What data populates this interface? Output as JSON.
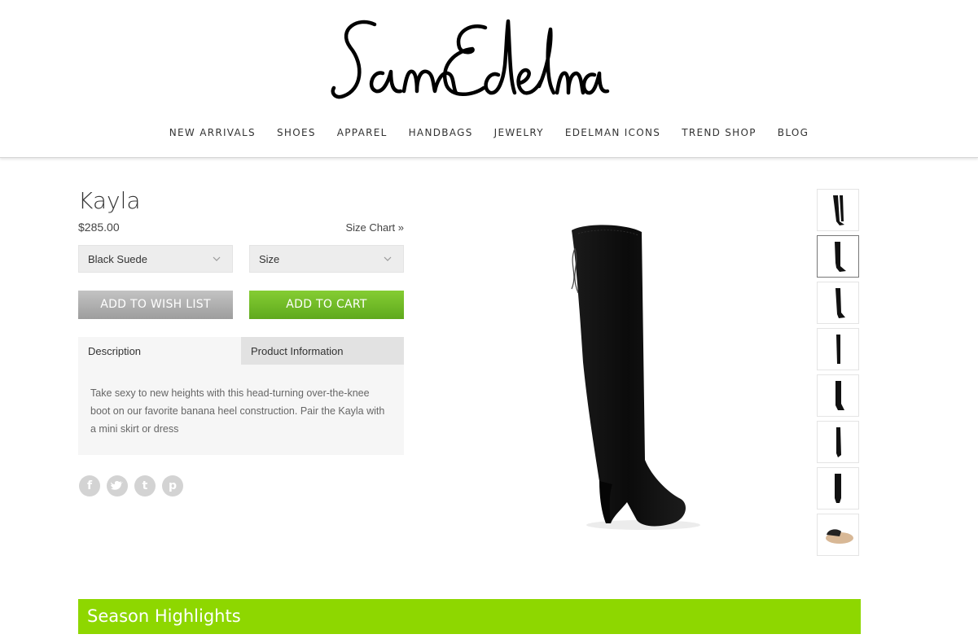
{
  "brand": {
    "logo_text": "Sam Edelman"
  },
  "nav": {
    "items": [
      "NEW ARRIVALS",
      "SHOES",
      "APPAREL",
      "HANDBAGS",
      "JEWELRY",
      "EDELMAN ICONS",
      "TREND SHOP",
      "BLOG"
    ]
  },
  "product": {
    "name": "Kayla",
    "price": "$285.00",
    "size_chart_label": "Size Chart »",
    "color_select": "Black Suede",
    "size_select": "Size",
    "wishlist_label": "ADD TO WISH LIST",
    "cart_label": "ADD TO CART",
    "tabs": [
      "Description",
      "Product Information"
    ],
    "description": "Take sexy to new heights with this head-turning over-the-knee boot on our favorite banana heel construction. Pair the Kayla with a mini skirt or dress"
  },
  "social": [
    {
      "icon": "facebook-icon",
      "glyph": "f"
    },
    {
      "icon": "twitter-icon",
      "glyph": "t"
    },
    {
      "icon": "tumblr-icon",
      "glyph": "t"
    },
    {
      "icon": "pinterest-icon",
      "glyph": "p"
    }
  ],
  "thumbnails_count": 8,
  "selected_thumbnail": 2,
  "season_highlights": "Season Highlights",
  "colors": {
    "accent_green": "#8ed700",
    "cart_green": "#6cb824",
    "wish_gray": "#aaaaaa"
  }
}
